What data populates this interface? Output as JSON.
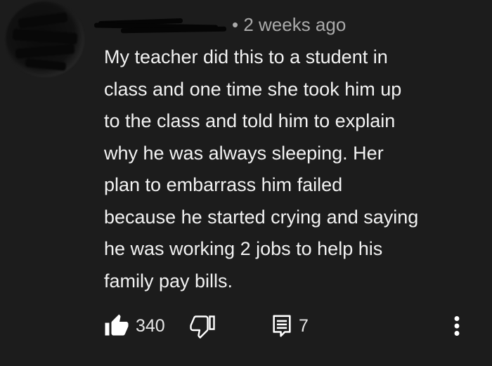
{
  "comment": {
    "timestamp": "• 2 weeks ago",
    "text_lines": [
      "My teacher did this to a student in",
      "class and one time she took him up",
      "to the class and told him to explain",
      "why he was always sleeping. Her",
      "plan to embarrass him failed",
      "because he started crying and saying",
      "he was working 2 jobs to help his",
      "family pay bills."
    ],
    "actions": {
      "like_icon": "thumbs-up-icon",
      "like_count": "340",
      "dislike_icon": "thumbs-down-icon",
      "reply_icon": "reply-icon",
      "reply_count": "7",
      "menu_icon": "more-vertical-icon"
    }
  },
  "colors": {
    "background": "#1c1c1c",
    "text": "#f2f2f2",
    "meta_text": "#aaaaaa"
  }
}
